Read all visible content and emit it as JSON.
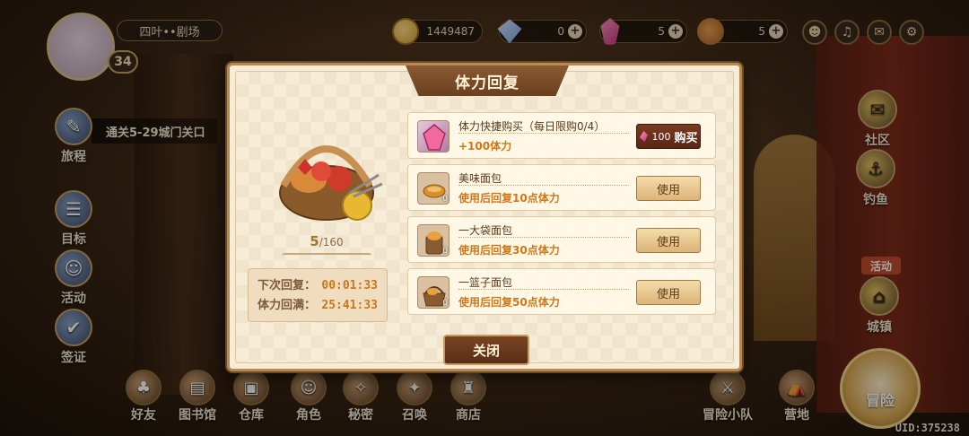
{
  "player": {
    "name": "四叶••剧场",
    "level": "34"
  },
  "resources": [
    {
      "icon": "coin-icon",
      "value": "1449487",
      "has_plus": false
    },
    {
      "icon": "diamond-icon",
      "value": "0",
      "has_plus": true
    },
    {
      "icon": "crystal-icon",
      "value": "5",
      "has_plus": true
    },
    {
      "icon": "bread-icon",
      "value": "5",
      "has_plus": true
    }
  ],
  "quest_text": "通关5-29城门关口",
  "left_nav": [
    "旅程",
    "目标",
    "活动",
    "签证"
  ],
  "right_nav": [
    "社区",
    "钓鱼",
    "城镇"
  ],
  "activity_tag": "活动",
  "bottom_nav": [
    "好友",
    "图书馆",
    "仓库",
    "角色",
    "秘密",
    "召唤",
    "商店",
    "冒险小队",
    "营地"
  ],
  "adventure_label": "冒险",
  "uid": "UID:375238",
  "dialog": {
    "title": "体力回复",
    "stamina_current": "5",
    "stamina_max": "/160",
    "timers": [
      {
        "label": "下次回复：",
        "value": "00:01:33"
      },
      {
        "label": "体力回满：",
        "value": "25:41:33"
      }
    ],
    "items": [
      {
        "icon": "crystal-icon",
        "name": "体力快捷购买（每日限购0/4）",
        "desc": "+100体力",
        "count": "",
        "button": "购买",
        "price": "100",
        "type": "buy"
      },
      {
        "icon": "bread-icon",
        "name": "美味面包",
        "desc": "使用后回复10点体力",
        "count": "0",
        "button": "使用",
        "type": "use"
      },
      {
        "icon": "bread-bag-icon",
        "name": "一大袋面包",
        "desc": "使用后回复30点体力",
        "count": "0",
        "button": "使用",
        "type": "use"
      },
      {
        "icon": "bread-basket-icon",
        "name": "一篮子面包",
        "desc": "使用后回复50点体力",
        "count": "0",
        "button": "使用",
        "type": "use"
      }
    ],
    "close_label": "关闭"
  }
}
